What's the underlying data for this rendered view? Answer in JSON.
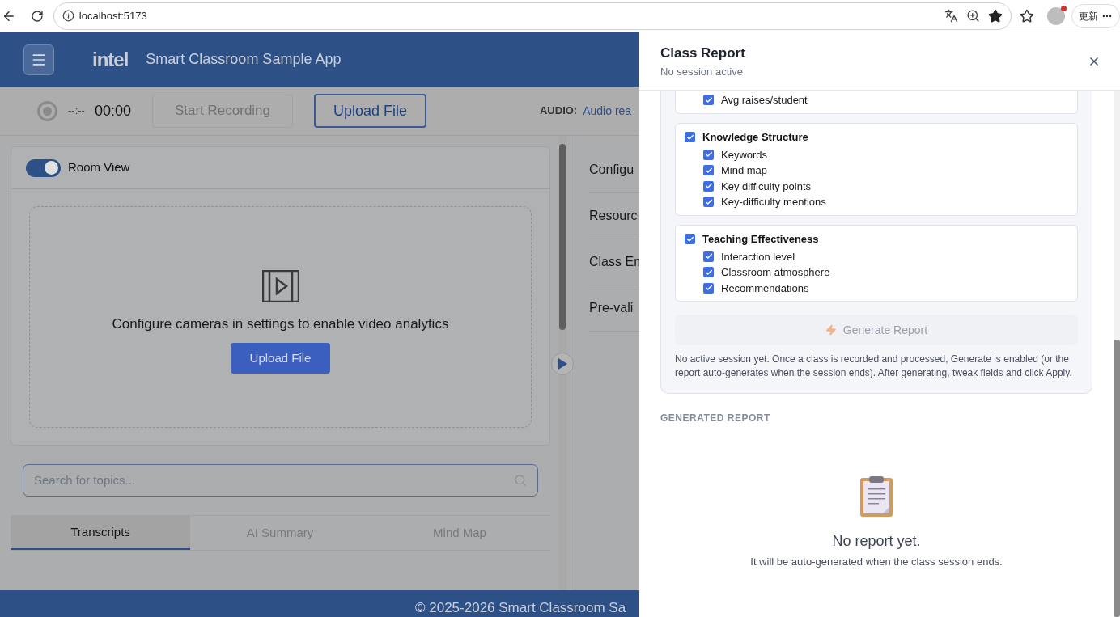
{
  "browser": {
    "url": "localhost:5173",
    "update_label": "更新"
  },
  "app": {
    "logo": "intel",
    "title": "Smart Classroom Sample App"
  },
  "toolbar": {
    "time_placeholder": "--:--",
    "timer": "00:00",
    "record_button": {
      "label": "Start Recording",
      "disabled": true
    },
    "upload_button": {
      "label": "Upload File"
    },
    "audio_label": "AUDIO:",
    "audio_value": "Audio rea"
  },
  "room_view": {
    "toggle": {
      "label": "Room View",
      "on": true
    },
    "message": "Configure cameras in settings to enable video analytics",
    "upload_button": {
      "label": "Upload File"
    }
  },
  "search": {
    "placeholder": "Search for topics..."
  },
  "tabs": [
    {
      "label": "Transcripts",
      "selected": true
    },
    {
      "label": "AI Summary",
      "selected": false
    },
    {
      "label": "Mind Map",
      "selected": false
    }
  ],
  "side_panel": {
    "items": [
      "Configu",
      "Resourc",
      "Class En",
      "Pre-vali"
    ]
  },
  "footer": {
    "text": "© 2025-2026 Smart Classroom Sa"
  },
  "drawer": {
    "title": "Class Report",
    "subtitle": "No session active",
    "sections": [
      {
        "children": [
          {
            "label": "Avg raises/student",
            "checked": true
          }
        ]
      },
      {
        "label": "Knowledge Structure",
        "checked": true,
        "children": [
          {
            "label": "Keywords",
            "checked": true
          },
          {
            "label": "Mind map",
            "checked": true
          },
          {
            "label": "Key difficulty points",
            "checked": true
          },
          {
            "label": "Key-difficulty mentions",
            "checked": true
          }
        ]
      },
      {
        "label": "Teaching Effectiveness",
        "checked": true,
        "children": [
          {
            "label": "Interaction level",
            "checked": true
          },
          {
            "label": "Classroom atmosphere",
            "checked": true
          },
          {
            "label": "Recommendations",
            "checked": true
          }
        ]
      }
    ],
    "generate_button": {
      "label": "Generate Report",
      "disabled": true
    },
    "note": "No active session yet. Once a class is recorded and processed, Generate is enabled (or the report auto-generates when the session ends). After generating, tweak fields and click Apply.",
    "generated_heading": "GENERATED REPORT",
    "empty_state": {
      "title": "No report yet.",
      "text": "It will be auto-generated when the class session ends."
    }
  }
}
